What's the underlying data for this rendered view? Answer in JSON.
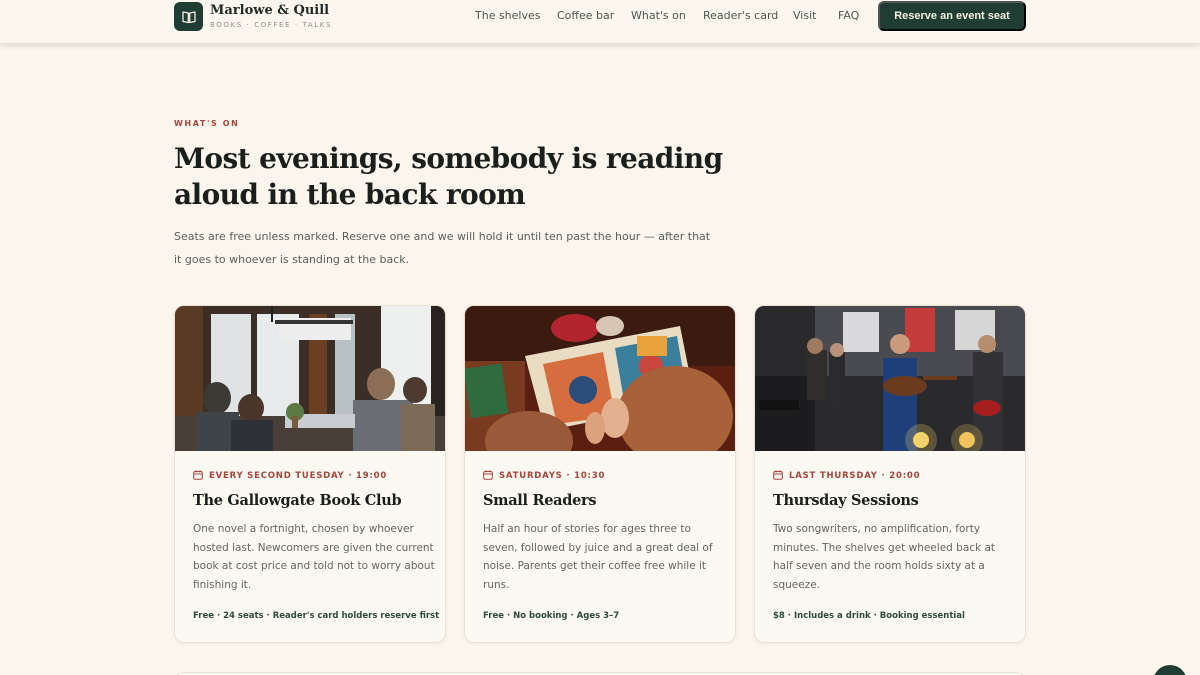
{
  "brand": {
    "name": "Marlowe & Quill",
    "tagline": "BOOKS · COFFEE · TALKS",
    "logo_icon": "open-book-icon",
    "color": "#1f3d32"
  },
  "nav": {
    "items": [
      "The shelves",
      "Coffee bar",
      "What's on",
      "Reader's card",
      "Visit",
      "FAQ"
    ],
    "cta": "Reserve an event seat"
  },
  "intro": {
    "eyebrow": "WHAT'S ON",
    "headline": "Most evenings, somebody is reading aloud in the back room",
    "lede": "Seats are free unless marked. Reserve one and we will hold it until ten past the hour — after that it goes to whoever is standing at the back."
  },
  "events": [
    {
      "when": "EVERY SECOND TUESDAY · 19:00",
      "title": "The Gallowgate Book Club",
      "description": "One novel a fortnight, chosen by whoever hosted last. Newcomers are given the current book at cost price and told not to worry about finishing it.",
      "meta": "Free · 24 seats · Reader's card holders reserve first",
      "icon": "calendar-icon"
    },
    {
      "when": "SATURDAYS · 10:30",
      "title": "Small Readers",
      "description": "Half an hour of stories for ages three to seven, followed by juice and a great deal of noise. Parents get their coffee free while it runs.",
      "meta": "Free · No booking · Ages 3–7",
      "icon": "calendar-icon"
    },
    {
      "when": "LAST THURSDAY · 20:00",
      "title": "Thursday Sessions",
      "description": "Two songwriters, no amplification, forty minutes. The shelves get wheeled back at half seven and the room holds sixty at a squeeze.",
      "meta": "$8 · Includes a drink · Booking essential",
      "icon": "calendar-icon"
    }
  ],
  "colors": {
    "accent": "#a4463a",
    "background": "#faf6ee",
    "dark_green": "#1f3d32"
  }
}
